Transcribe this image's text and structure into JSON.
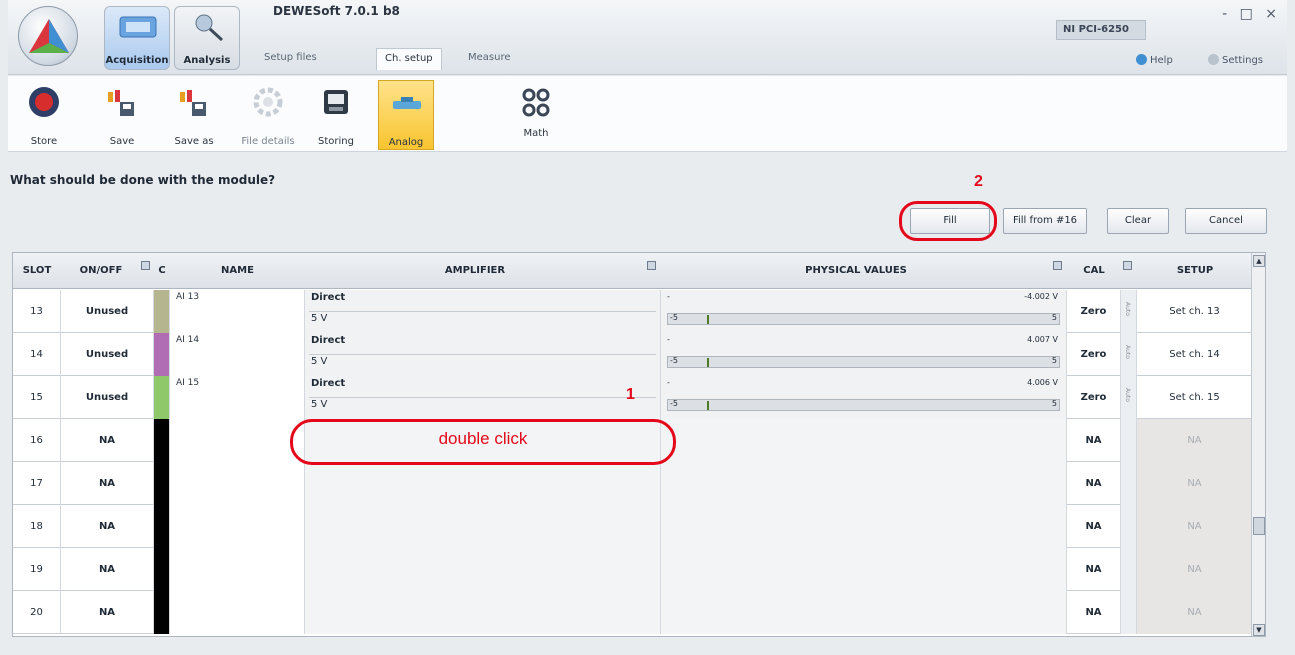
{
  "window": {
    "title": "DEWESoft 7.0.1 b8",
    "device": "NI PCI-6250",
    "controls": "- □ ×",
    "help": "Help",
    "settings": "Settings"
  },
  "main_tabs": [
    {
      "label": "Acquisition",
      "active": true
    },
    {
      "label": "Analysis",
      "active": false
    }
  ],
  "sub_tabs": [
    {
      "label": "Setup files"
    },
    {
      "label": "Ch. setup",
      "active": true
    },
    {
      "label": "Measure"
    }
  ],
  "toolbar": [
    {
      "label": "Store",
      "icon": "record-icon"
    },
    {
      "label": "Save",
      "icon": "save-icon"
    },
    {
      "label": "Save as",
      "icon": "save-as-icon"
    },
    {
      "label": "File details",
      "icon": "file-details-icon"
    },
    {
      "label": "Storing",
      "icon": "storing-icon"
    },
    {
      "label": "Analog",
      "icon": "analog-icon",
      "active": true
    },
    {
      "label": "Math",
      "icon": "math-icon"
    }
  ],
  "question": "What should be done with the module?",
  "buttons": {
    "fill": "Fill",
    "fill_from": "Fill from #16",
    "clear": "Clear",
    "cancel": "Cancel"
  },
  "columns": {
    "slot": "SLOT",
    "onoff": "ON/OFF",
    "c": "C",
    "name": "NAME",
    "amplifier": "AMPLIFIER",
    "physical": "PHYSICAL VALUES",
    "cal": "CAL",
    "setup": "SETUP"
  },
  "rows": [
    {
      "slot": "13",
      "onoff": "Unused",
      "color": "#b5b58f",
      "name": "AI 13",
      "amp_type": "Direct",
      "amp_range": "5 V",
      "value": "-4.002 V",
      "lo": "-5",
      "hi": "5",
      "needle": 0.1,
      "cal": "Zero",
      "auto": "Auto",
      "setup": "Set ch. 13"
    },
    {
      "slot": "14",
      "onoff": "Unused",
      "color": "#b06db3",
      "name": "AI 14",
      "amp_type": "Direct",
      "amp_range": "5 V",
      "value": "4.007 V",
      "lo": "-5",
      "hi": "5",
      "needle": 0.1,
      "cal": "Zero",
      "auto": "Auto",
      "setup": "Set ch. 14"
    },
    {
      "slot": "15",
      "onoff": "Unused",
      "color": "#8fc86b",
      "name": "AI 15",
      "amp_type": "Direct",
      "amp_range": "5 V",
      "value": "4.006 V",
      "lo": "-5",
      "hi": "5",
      "needle": 0.1,
      "cal": "Zero",
      "auto": "Auto",
      "setup": "Set ch. 15"
    },
    {
      "slot": "16",
      "onoff": "NA",
      "cal": "NA",
      "setup": "NA"
    },
    {
      "slot": "17",
      "onoff": "NA",
      "cal": "NA",
      "setup": "NA"
    },
    {
      "slot": "18",
      "onoff": "NA",
      "cal": "NA",
      "setup": "NA"
    },
    {
      "slot": "19",
      "onoff": "NA",
      "cal": "NA",
      "setup": "NA"
    },
    {
      "slot": "20",
      "onoff": "NA",
      "cal": "NA",
      "setup": "NA"
    }
  ],
  "annotations": {
    "step1": "1",
    "step1_text": "double click",
    "step2": "2",
    "color": "#e4081a"
  }
}
